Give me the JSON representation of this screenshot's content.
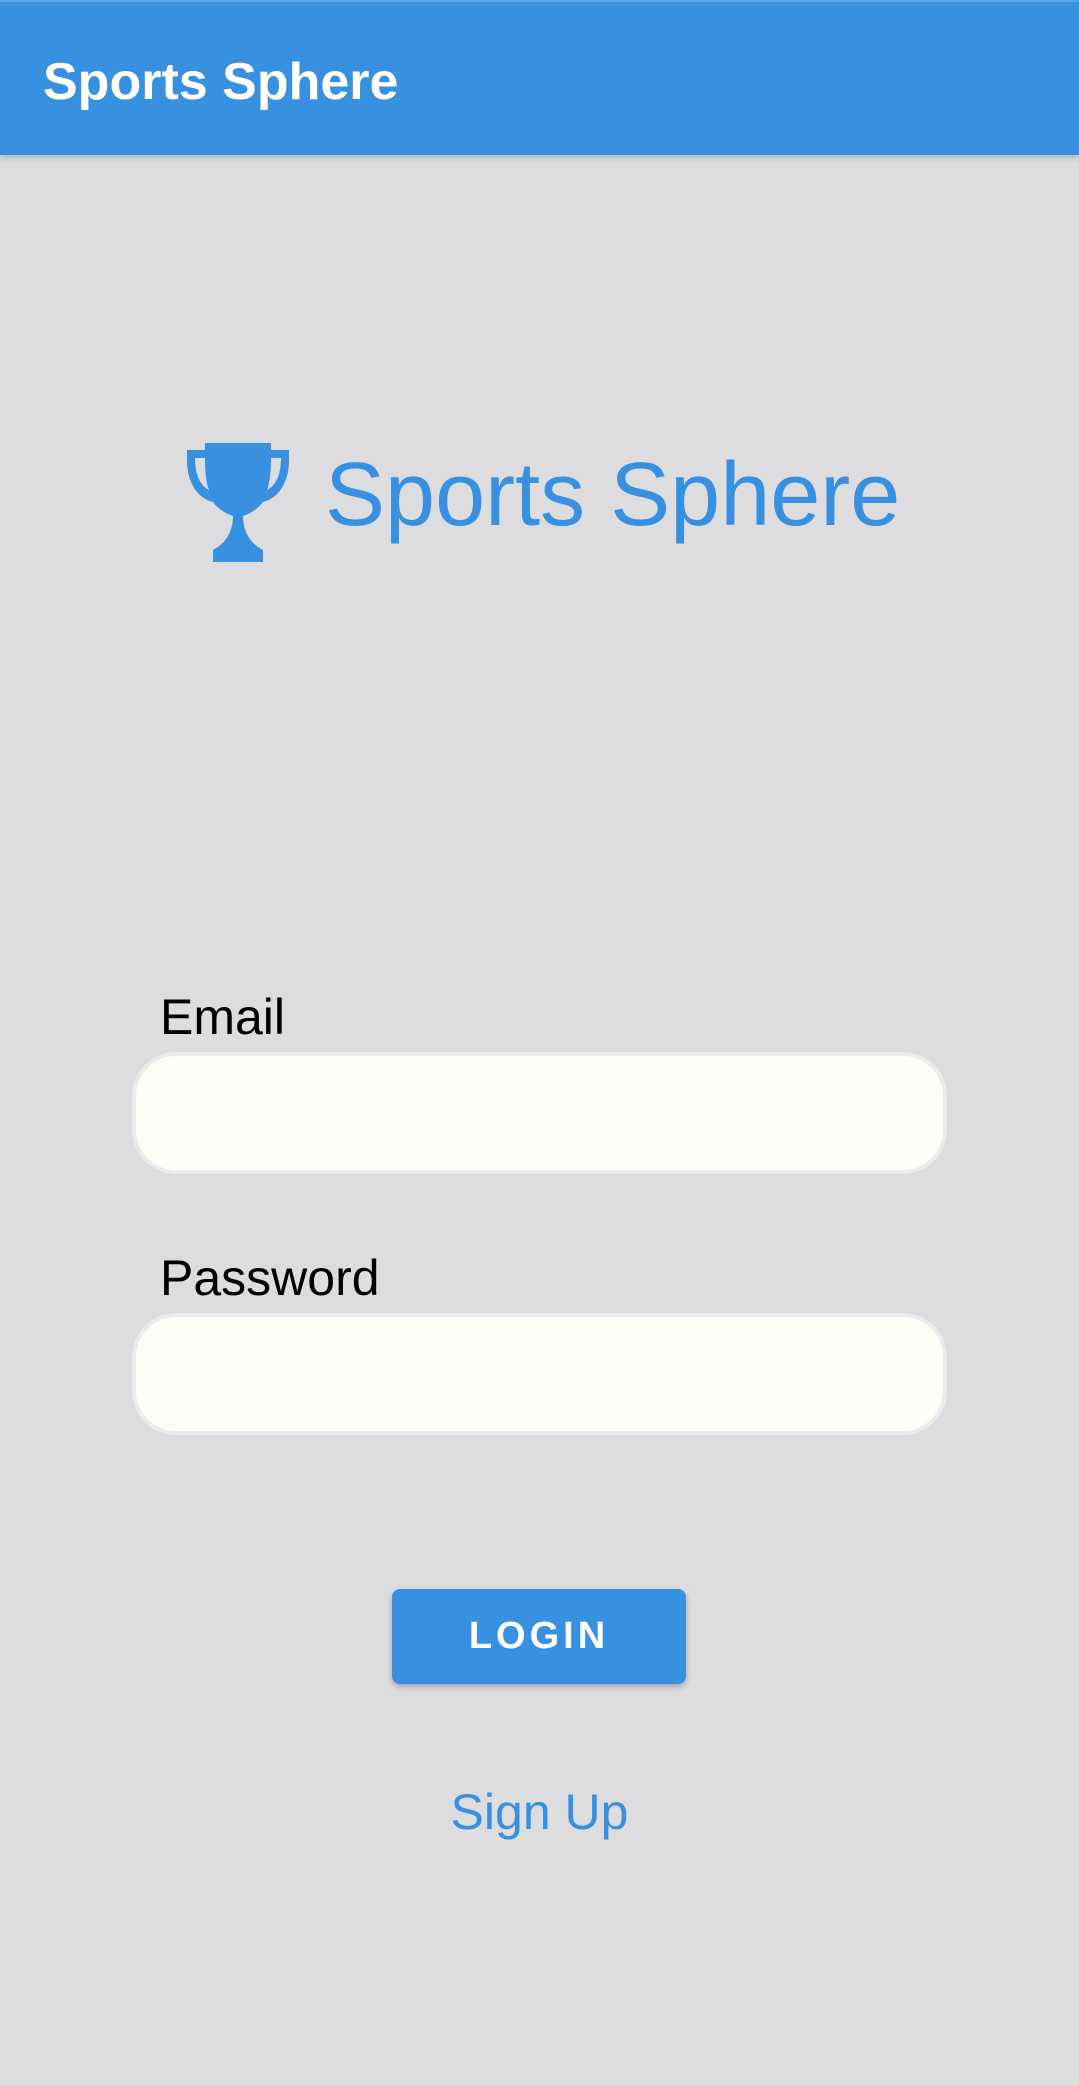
{
  "app_bar": {
    "title": "Sports Sphere"
  },
  "logo": {
    "icon": "trophy-icon",
    "text": "Sports Sphere"
  },
  "form": {
    "email": {
      "label": "Email",
      "value": "",
      "placeholder": ""
    },
    "password": {
      "label": "Password",
      "value": "",
      "placeholder": ""
    },
    "login_label": "LOGIN",
    "signup_label": "Sign Up"
  },
  "colors": {
    "accent": "#3790e0",
    "background": "#dddddf",
    "input_background": "#fefef9"
  }
}
